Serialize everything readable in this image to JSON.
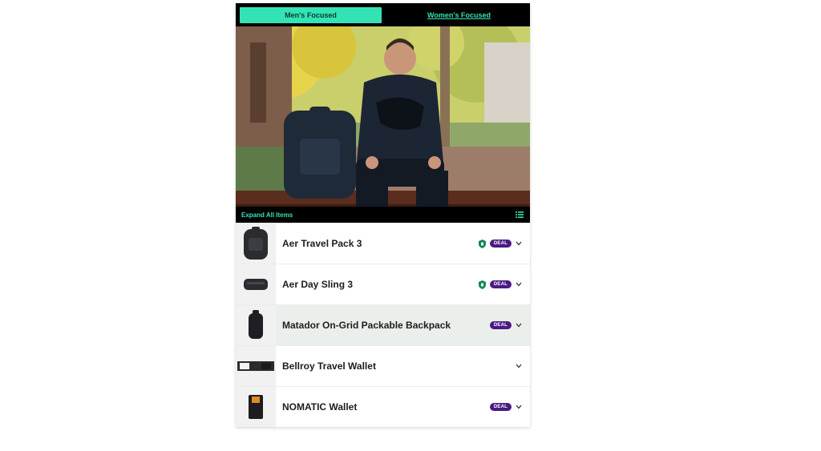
{
  "tabs": [
    {
      "label": "Men's Focused",
      "active": true
    },
    {
      "label": "Women's Focused",
      "active": false
    }
  ],
  "hero": {
    "expand_label": "Expand All Items",
    "list_icon": "list-icon"
  },
  "colors": {
    "accent": "#34e3b5",
    "deal": "#4a1a83",
    "shield": "#0f8a57"
  },
  "items": [
    {
      "name": "Aer Travel Pack 3",
      "shield": true,
      "deal": "DEAL"
    },
    {
      "name": "Aer Day Sling 3",
      "shield": true,
      "deal": "DEAL"
    },
    {
      "name": "Matador On-Grid Packable Backpack",
      "shield": false,
      "deal": "DEAL"
    },
    {
      "name": "Bellroy Travel Wallet",
      "shield": false,
      "deal": ""
    },
    {
      "name": "NOMATIC Wallet",
      "shield": false,
      "deal": "DEAL"
    }
  ]
}
